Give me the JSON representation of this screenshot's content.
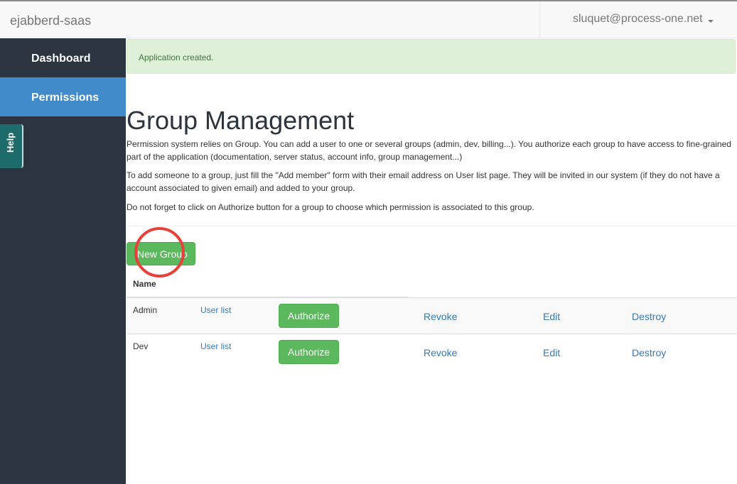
{
  "navbar": {
    "brand": "ejabberd-saas",
    "user_email": "sluquet@process-one.net"
  },
  "sidebar": {
    "items": [
      {
        "label": "Dashboard",
        "active": false
      },
      {
        "label": "Permissions",
        "active": true
      }
    ],
    "help_label": "Help"
  },
  "alert": {
    "text": "Application created."
  },
  "page": {
    "title": "Group Management",
    "paragraphs": [
      "Permission system relies on Group. You can add a user to one or several groups (admin, dev, billing...). You authorize each group to have access to fine-grained part of the application (documentation, server status, account info, group management...)",
      "To add someone to a group, just fill the \"Add member\" form with their email address on User list page. They will be invited in our system (if they do not have a account associated to given email) and added to your group.",
      "Do not forget to click on Authorize button for a group to choose which permission is associated to this group."
    ],
    "new_group_label": "New Group"
  },
  "table": {
    "header_name": "Name",
    "rows": [
      {
        "name": "Admin",
        "user_list": "User list",
        "authorize": "Authorize",
        "revoke": "Revoke",
        "edit": "Edit",
        "destroy": "Destroy"
      },
      {
        "name": "Dev",
        "user_list": "User list",
        "authorize": "Authorize",
        "revoke": "Revoke",
        "edit": "Edit",
        "destroy": "Destroy"
      }
    ]
  },
  "colors": {
    "sidebar_bg": "#2c3440",
    "active_item": "#428bca",
    "success_button": "#5cb85c",
    "link": "#337ab7",
    "alert_bg": "#dff0d8",
    "highlight_circle": "#e8413a"
  }
}
